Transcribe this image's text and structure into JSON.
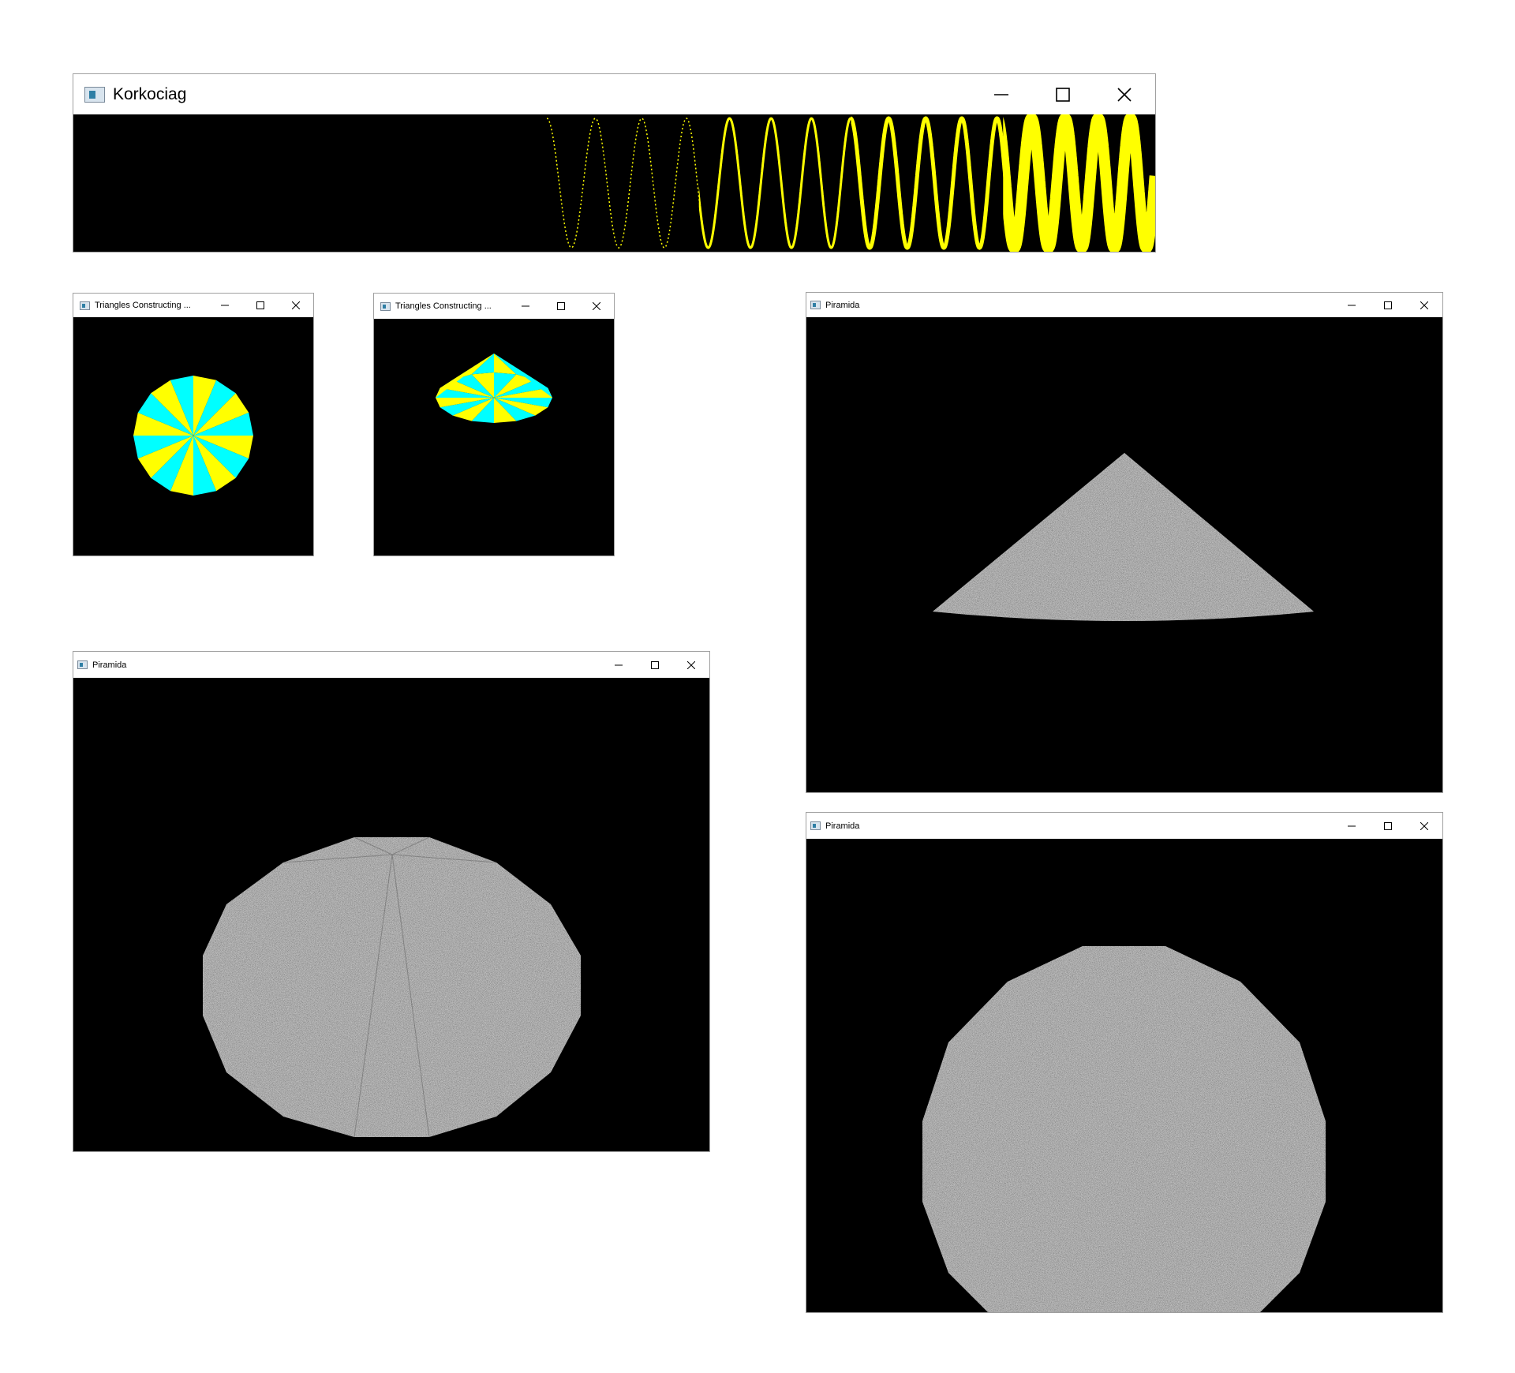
{
  "colors": {
    "yellow": "#ffff00",
    "cyan": "#00ffff",
    "canvas": "#000000",
    "stone": "#4a4a4a"
  },
  "korkociag": {
    "title": "Korkociag",
    "icons": {
      "app": "app-window-icon",
      "minimize": "minimize-icon",
      "maximize": "maximize-icon",
      "close": "close-icon"
    }
  },
  "triangles_1": {
    "title": "Triangles Constructing ..."
  },
  "triangles_2": {
    "title": "Triangles Constructing ..."
  },
  "piramida_1": {
    "title": "Piramida"
  },
  "piramida_2": {
    "title": "Piramida"
  },
  "piramida_3": {
    "title": "Piramida"
  }
}
